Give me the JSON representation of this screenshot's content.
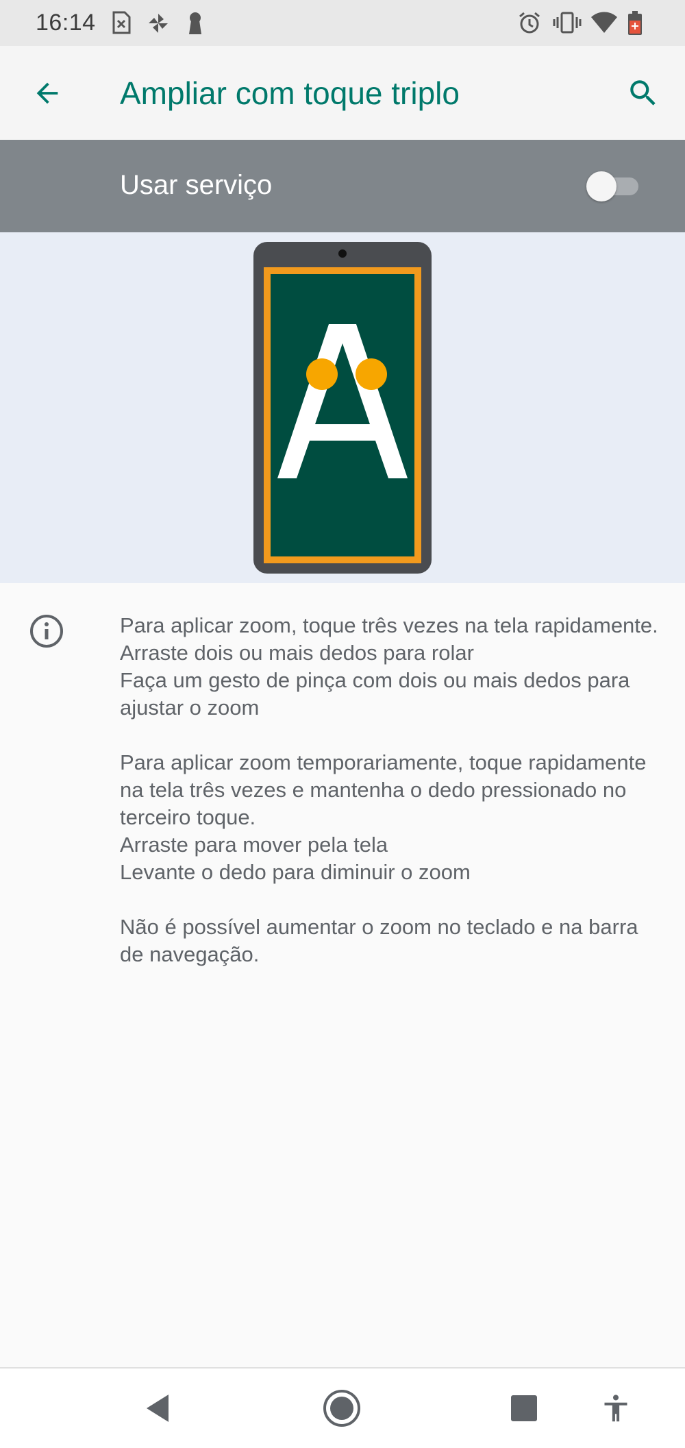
{
  "status_bar": {
    "time": "16:14",
    "left_icons": [
      "sim-icon",
      "pinwheel-icon",
      "keyhole-icon"
    ],
    "right_icons": [
      "alarm-icon",
      "vibrate-icon",
      "wifi-icon",
      "battery-icon"
    ]
  },
  "app_bar": {
    "title": "Ampliar com toque triplo",
    "back_icon": "arrow-back-icon",
    "search_icon": "search-icon"
  },
  "service": {
    "label": "Usar serviço",
    "enabled": false
  },
  "info": {
    "icon": "info-icon",
    "paragraphs": [
      [
        "Para aplicar zoom, toque três vezes na tela rapidamente.",
        "Arraste dois ou mais dedos para rolar",
        "Faça um gesto de pinça com dois ou mais dedos para ajustar o zoom"
      ],
      [
        "Para aplicar zoom temporariamente, toque rapidamente na tela três vezes e mantenha o dedo pressionado no terceiro toque.",
        "Arraste para mover pela tela",
        "Levante o dedo para diminuir o zoom"
      ],
      [
        "Não é possível aumentar o zoom no teclado e na barra de navegação."
      ]
    ]
  },
  "nav_bar": {
    "buttons": [
      "back-triangle-icon",
      "home-circle-icon",
      "recents-square-icon",
      "accessibility-icon"
    ]
  },
  "colors": {
    "accent": "#00796b",
    "service_bar": "#80868b",
    "illustration_bg": "#e8edf6",
    "screen_green": "#004d40",
    "screen_border": "#f29a1d",
    "tap_dot": "#f7a600"
  }
}
